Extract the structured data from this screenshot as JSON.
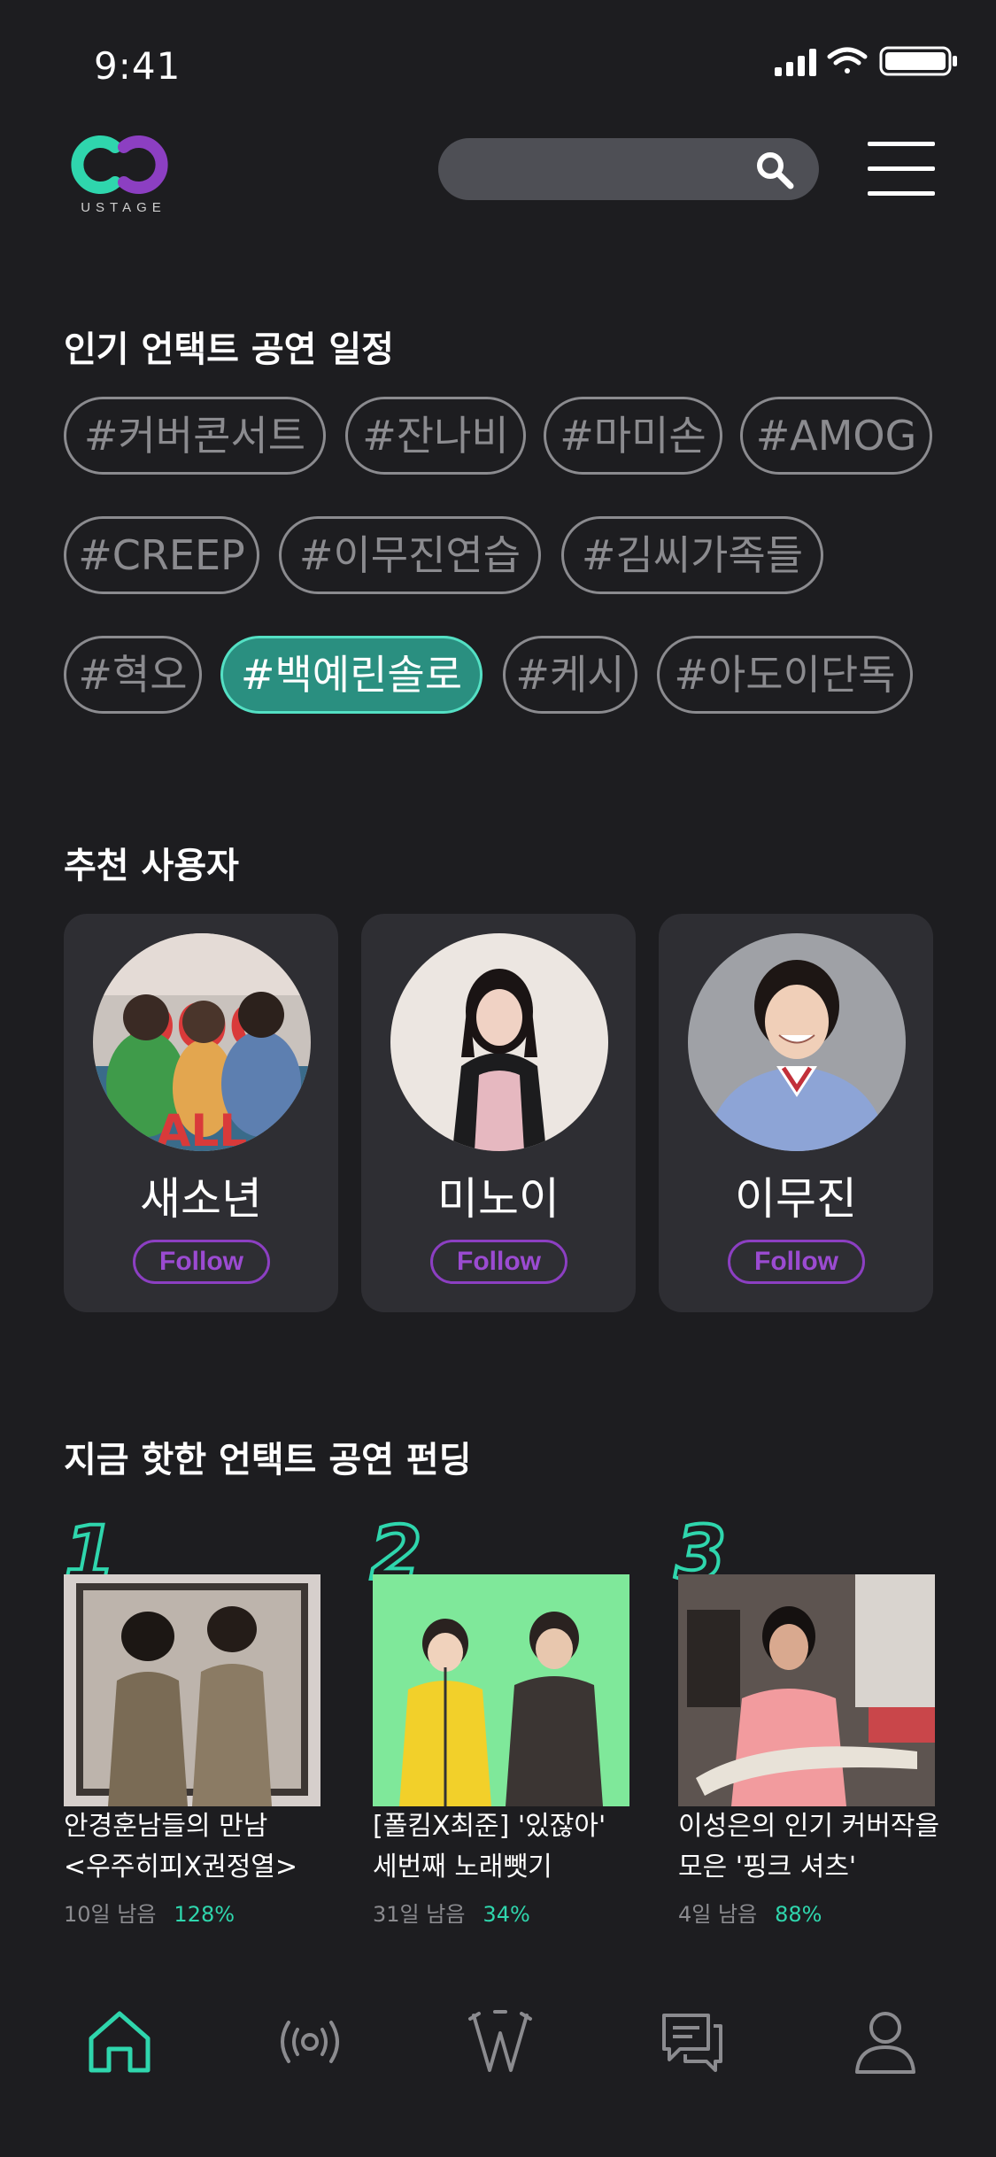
{
  "status": {
    "time": "9:41"
  },
  "header": {
    "logo_text": "USTAGE",
    "search_placeholder": ""
  },
  "tags_section": {
    "title": "인기 언택트 공연 일정",
    "tags": [
      "#커버콘서트",
      "#잔나비",
      "#마미손",
      "#AMOG",
      "#CREEP",
      "#이무진연습",
      "#김씨가족들",
      "#혁오",
      "#백예린솔로",
      "#케시",
      "#아도이단독"
    ],
    "active_tag": "#백예린솔로"
  },
  "users_section": {
    "title": "추천 사용자",
    "users": [
      {
        "name": "새소년",
        "follow_label": "Follow"
      },
      {
        "name": "미노이",
        "follow_label": "Follow"
      },
      {
        "name": "이무진",
        "follow_label": "Follow"
      }
    ]
  },
  "trending_section": {
    "title": "지금 핫한 언택트 공연 펀딩",
    "items": [
      {
        "rank": "1",
        "title_line1": "안경훈남들의 만남",
        "title_line2": "<우주히피X권정열>",
        "remaining": "10일 남음",
        "percent": "128%"
      },
      {
        "rank": "2",
        "title_line1": "[폴킴X최준] '있잖아'",
        "title_line2": "세번째 노래뺏기",
        "remaining": "31일 남음",
        "percent": "34%"
      },
      {
        "rank": "3",
        "title_line1": "이성은의 인기 커버작을",
        "title_line2": "모은 '핑크 셔츠'",
        "remaining": "4일 남음",
        "percent": "88%"
      }
    ]
  },
  "bottom_nav": {
    "items": [
      "home-icon",
      "broadcast-icon",
      "stage-icon",
      "chat-icon",
      "profile-icon"
    ],
    "active": "home-icon"
  },
  "colors": {
    "background": "#1d1d20",
    "accent_teal": "#2fd6ad",
    "accent_purple": "#8c3fc2",
    "card": "#2e2e33"
  }
}
